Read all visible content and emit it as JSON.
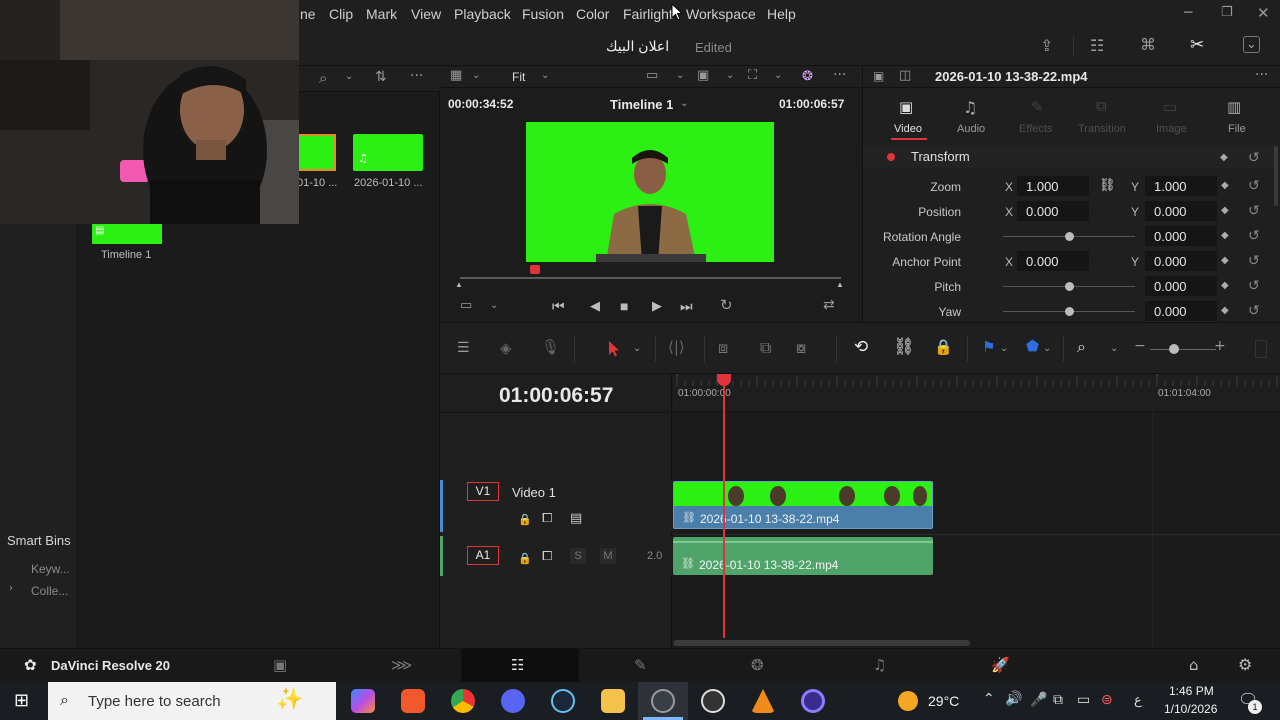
{
  "menu": {
    "items": [
      "ne",
      "Clip",
      "Mark",
      "View",
      "Playback",
      "Fusion",
      "Color",
      "Fairlight",
      "Workspace",
      "Help"
    ]
  },
  "header": {
    "project_title": "اعلان البيك",
    "status": "Edited"
  },
  "media_pool": {
    "clips": [
      {
        "name": "01-10 ..."
      },
      {
        "name": "2026-01-10 ..."
      }
    ],
    "timeline_item": "Timeline 1",
    "smart_bins_label": "Smart Bins",
    "smart_bins": [
      "Keyw...",
      "Colle..."
    ]
  },
  "viewer": {
    "zoom_label": "Fit",
    "source_timecode": "00:00:34:52",
    "timeline_name": "Timeline 1",
    "record_timecode": "01:00:06:57",
    "playhead_fraction": 0.2
  },
  "inspector": {
    "clip_name": "2026-01-10 13-38-22.mp4",
    "tabs": [
      "Video",
      "Audio",
      "Effects",
      "Transition",
      "Image",
      "File"
    ],
    "section_title": "Transform",
    "rows": [
      {
        "label": "Zoom",
        "x": "1.000",
        "y": "1.000"
      },
      {
        "label": "Position",
        "x": "0.000",
        "y": "0.000"
      },
      {
        "label": "Rotation Angle",
        "value": "0.000"
      },
      {
        "label": "Anchor Point",
        "x": "0.000",
        "y": "0.000"
      },
      {
        "label": "Pitch",
        "value": "0.000"
      },
      {
        "label": "Yaw",
        "value": "0.000"
      }
    ],
    "axis_x": "X",
    "axis_y": "Y"
  },
  "timeline": {
    "timecode": "01:00:06:57",
    "ruler_labels": [
      "01:00:00:00",
      "01:01:04:00"
    ],
    "tracks": [
      {
        "id": "V1",
        "name": "Video 1"
      },
      {
        "id": "A1",
        "volume": "2.0",
        "solo": "S",
        "mute": "M"
      }
    ],
    "video_clip_name": "2026-01-10 13-38-22.mp4",
    "audio_clip_name": "2026-01-10 13-38-22.mp4"
  },
  "dock": {
    "app_name": "DaVinci Resolve 20"
  },
  "taskbar": {
    "search_placeholder": "Type here to search",
    "temperature": "29°C",
    "language": "ع",
    "time": "1:46 PM",
    "date": "1/10/2026",
    "notification_count": "1"
  },
  "colors": {
    "green_screen": "#2cf013",
    "accent_red": "#e0333a",
    "video_clip_blue": "#4a7faa",
    "audio_clip_green": "#4fa46a"
  }
}
